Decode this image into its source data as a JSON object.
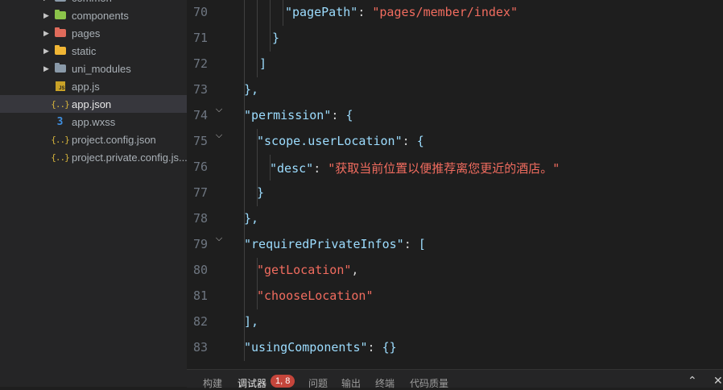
{
  "explorer": {
    "items": [
      {
        "label": "common",
        "icon": "folder-icon",
        "color": "#8a9aa9"
      },
      {
        "label": "components",
        "icon": "components-folder-icon",
        "color": "#8bc34a"
      },
      {
        "label": "pages",
        "icon": "pages-folder-icon",
        "color": "#e06b5b"
      },
      {
        "label": "static",
        "icon": "static-folder-icon",
        "color": "#f1b635"
      },
      {
        "label": "uni_modules",
        "icon": "folder-icon",
        "color": "#8a9aa9"
      },
      {
        "label": "app.js",
        "icon": "js-file-icon",
        "badge": "JS"
      },
      {
        "label": "app.json",
        "icon": "json-file-icon",
        "badge": "{..}"
      },
      {
        "label": "app.wxss",
        "icon": "css-file-icon",
        "badge": "3"
      },
      {
        "label": "project.config.json",
        "icon": "json-file-icon",
        "badge": "{..}"
      },
      {
        "label": "project.private.config.js...",
        "icon": "json-file-icon",
        "badge": "{..}"
      }
    ],
    "selected": "app.json"
  },
  "editor": {
    "lines": [
      {
        "num": "70",
        "tokens": [
          {
            "t": "\"pagePath\"",
            "c": "k"
          },
          {
            "t": ": ",
            "c": "p"
          },
          {
            "t": "\"pages/member/index\"",
            "c": "s"
          }
        ]
      },
      {
        "num": "71",
        "tokens": [
          {
            "t": "}",
            "c": "b"
          }
        ]
      },
      {
        "num": "72",
        "tokens": [
          {
            "t": "]",
            "c": "b"
          }
        ]
      },
      {
        "num": "73",
        "tokens": [
          {
            "t": "},",
            "c": "b"
          }
        ]
      },
      {
        "num": "74",
        "tokens": [
          {
            "t": "\"permission\"",
            "c": "k"
          },
          {
            "t": ": ",
            "c": "p"
          },
          {
            "t": "{",
            "c": "b"
          }
        ]
      },
      {
        "num": "75",
        "tokens": [
          {
            "t": "\"scope.userLocation\"",
            "c": "k"
          },
          {
            "t": ": ",
            "c": "p"
          },
          {
            "t": "{",
            "c": "b"
          }
        ]
      },
      {
        "num": "76",
        "tokens": [
          {
            "t": "\"desc\"",
            "c": "k"
          },
          {
            "t": ": ",
            "c": "p"
          },
          {
            "t": "\"获取当前位置以便推荐离您更近的酒店。\"",
            "c": "s"
          }
        ]
      },
      {
        "num": "77",
        "tokens": [
          {
            "t": "}",
            "c": "b"
          }
        ]
      },
      {
        "num": "78",
        "tokens": [
          {
            "t": "},",
            "c": "b"
          }
        ]
      },
      {
        "num": "79",
        "tokens": [
          {
            "t": "\"requiredPrivateInfos\"",
            "c": "k"
          },
          {
            "t": ": ",
            "c": "p"
          },
          {
            "t": "[",
            "c": "b"
          }
        ]
      },
      {
        "num": "80",
        "tokens": [
          {
            "t": "\"getLocation\"",
            "c": "s"
          },
          {
            "t": ",",
            "c": "p"
          }
        ]
      },
      {
        "num": "81",
        "tokens": [
          {
            "t": "\"chooseLocation\"",
            "c": "s"
          }
        ]
      },
      {
        "num": "82",
        "tokens": [
          {
            "t": "],",
            "c": "b"
          }
        ]
      },
      {
        "num": "83",
        "tokens": [
          {
            "t": "\"usingComponents\"",
            "c": "k"
          },
          {
            "t": ": ",
            "c": "p"
          },
          {
            "t": "{}",
            "c": "b"
          }
        ]
      }
    ]
  },
  "panel": {
    "tabs": [
      "构建",
      "调试器",
      "问题",
      "输出",
      "终端",
      "代码质量"
    ],
    "active_tab": "调试器",
    "debugger_badge": "1, 8",
    "collapse_icon": "chevron-up-icon",
    "close_icon": "close-icon"
  }
}
